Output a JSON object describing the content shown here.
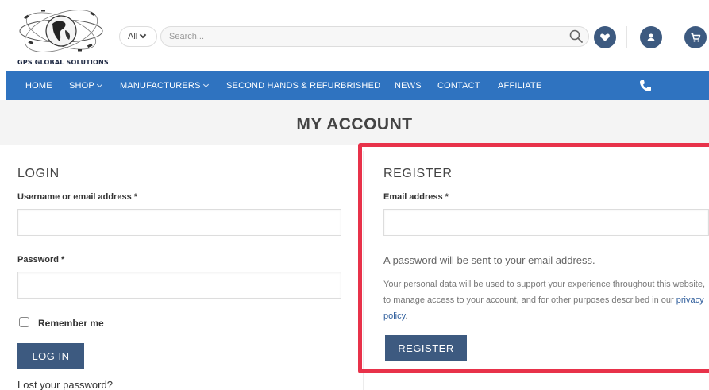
{
  "header": {
    "logo_text": "GPS GLOBAL SOLUTIONS",
    "category_select": "All",
    "search_placeholder": "Search...",
    "icons": [
      "search-icon",
      "heart-icon",
      "user-icon",
      "cart-icon"
    ]
  },
  "nav": {
    "items": [
      {
        "label": "HOME",
        "dropdown": false
      },
      {
        "label": "SHOP",
        "dropdown": true
      },
      {
        "label": "MANUFACTURERS",
        "dropdown": true
      },
      {
        "label": "SECOND HANDS & REFURBRISHED",
        "dropdown": false
      },
      {
        "label": "NEWS",
        "dropdown": false
      },
      {
        "label": "CONTACT",
        "dropdown": false
      },
      {
        "label": "AFFILIATE",
        "dropdown": false
      }
    ],
    "phone_icon": "phone-icon"
  },
  "page": {
    "title": "MY ACCOUNT"
  },
  "login": {
    "heading": "LOGIN",
    "username_label": "Username or email address *",
    "username_value": "",
    "password_label": "Password *",
    "password_value": "",
    "remember_label": "Remember me",
    "remember_checked": false,
    "button_label": "LOG IN",
    "lost_password": "Lost your password?"
  },
  "register": {
    "heading": "REGISTER",
    "email_label": "Email address *",
    "email_value": "",
    "password_note": "A password will be sent to your email address.",
    "privacy_text": "Your personal data will be used to support your experience throughout this website, to manage access to your account, and for other purposes described in our",
    "privacy_link": "privacy policy",
    "privacy_end": ".",
    "button_label": "REGISTER"
  },
  "colors": {
    "nav_bg": "#2f73c0",
    "button_bg": "#3d5a80",
    "highlight": "#e8324a"
  }
}
